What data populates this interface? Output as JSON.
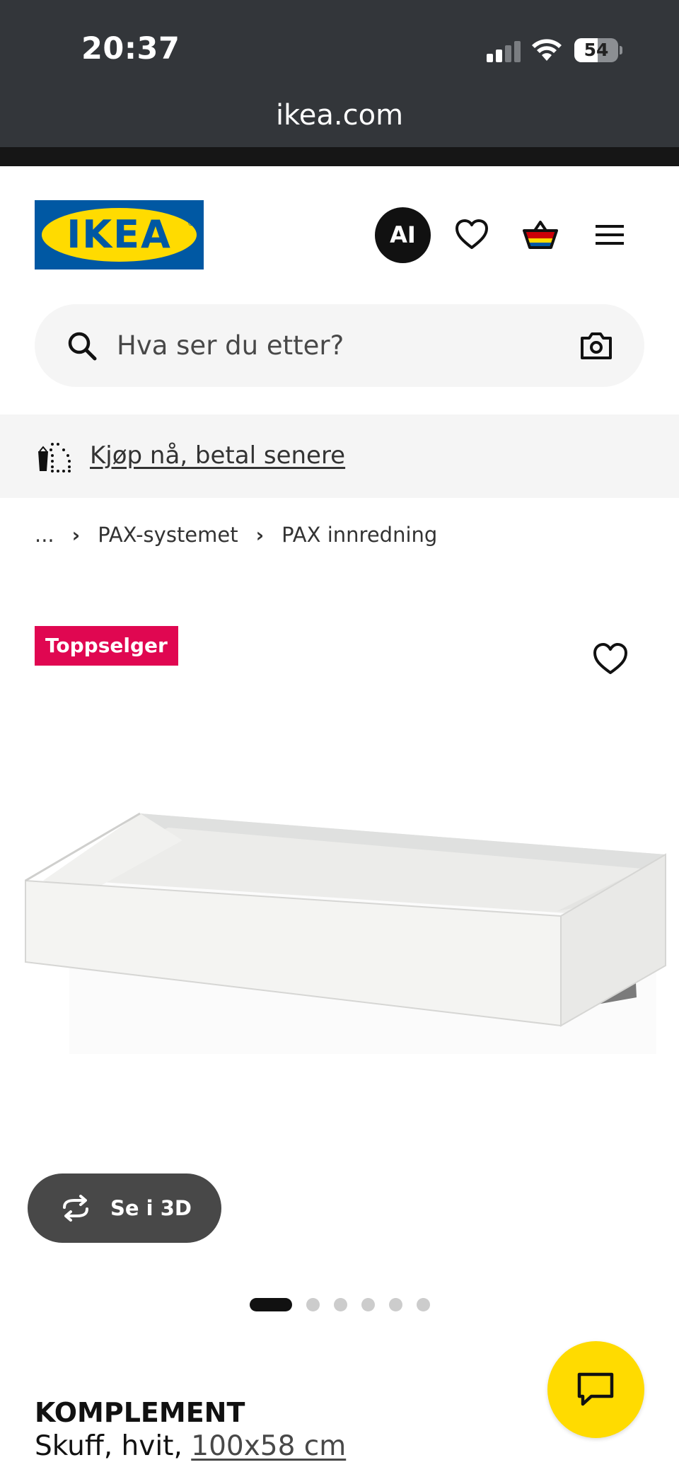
{
  "status_bar": {
    "time": "20:37",
    "battery": "54",
    "battery_level": 0.54
  },
  "browser": {
    "url": "ikea.com"
  },
  "header": {
    "logo_text": "IKEA",
    "ai_label": "AI",
    "icons": [
      "heart-icon",
      "basket-icon",
      "menu-icon"
    ]
  },
  "search": {
    "placeholder": "Hva ser du etter?"
  },
  "banner": {
    "link": "Kjøp nå, betal senere"
  },
  "breadcrumb": {
    "ellipsis": "...",
    "items": [
      "PAX-systemet",
      "PAX innredning"
    ]
  },
  "product": {
    "badge": "Toppselger",
    "view_3d": "Se i 3D",
    "carousel_count": 6,
    "carousel_active": 0,
    "name": "KOMPLEMENT",
    "desc_prefix": "Skuff, hvit, ",
    "size": "100x58 cm"
  },
  "colors": {
    "ikea_blue": "#0058a3",
    "ikea_yellow": "#ffdb00",
    "badge_red": "#e00751"
  }
}
